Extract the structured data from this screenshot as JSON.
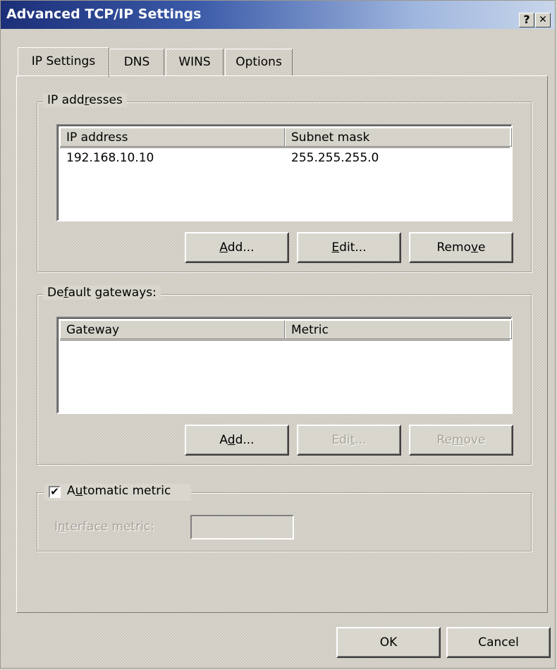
{
  "window": {
    "title": "Advanced TCP/IP Settings",
    "help_button": "?",
    "close_button": "✕"
  },
  "tabs": [
    {
      "label": "IP Settings",
      "active": true
    },
    {
      "label": "DNS",
      "active": false
    },
    {
      "label": "WINS",
      "active": false
    },
    {
      "label": "Options",
      "active": false
    }
  ],
  "ip_addresses": {
    "legend_pre": "IP add",
    "legend_u": "r",
    "legend_post": "esses",
    "columns": [
      "IP address",
      "Subnet mask"
    ],
    "rows": [
      {
        "ip": "192.168.10.10",
        "mask": "255.255.255.0"
      }
    ],
    "add": {
      "pre": "",
      "u": "A",
      "post": "dd..."
    },
    "edit": {
      "pre": "",
      "u": "E",
      "post": "dit..."
    },
    "remove": {
      "pre": "Remo",
      "u": "v",
      "post": "e"
    }
  },
  "gateways": {
    "legend_pre": "De",
    "legend_u": "f",
    "legend_post": "ault gateways:",
    "columns": [
      "Gateway",
      "Metric"
    ],
    "rows": [],
    "add": {
      "pre": "A",
      "u": "d",
      "post": "d..."
    },
    "edit": {
      "pre": "Edi",
      "u": "t",
      "post": "..."
    },
    "remove": {
      "pre": "Re",
      "u": "m",
      "post": "ove"
    }
  },
  "metric": {
    "checkbox_checked": true,
    "check_mark": "✔",
    "label_pre": "A",
    "label_u": "u",
    "label_post": "tomatic metric",
    "interface_pre": "I",
    "interface_u": "n",
    "interface_post": "terface metric:",
    "interface_value": ""
  },
  "footer": {
    "ok": "OK",
    "cancel": "Cancel"
  }
}
